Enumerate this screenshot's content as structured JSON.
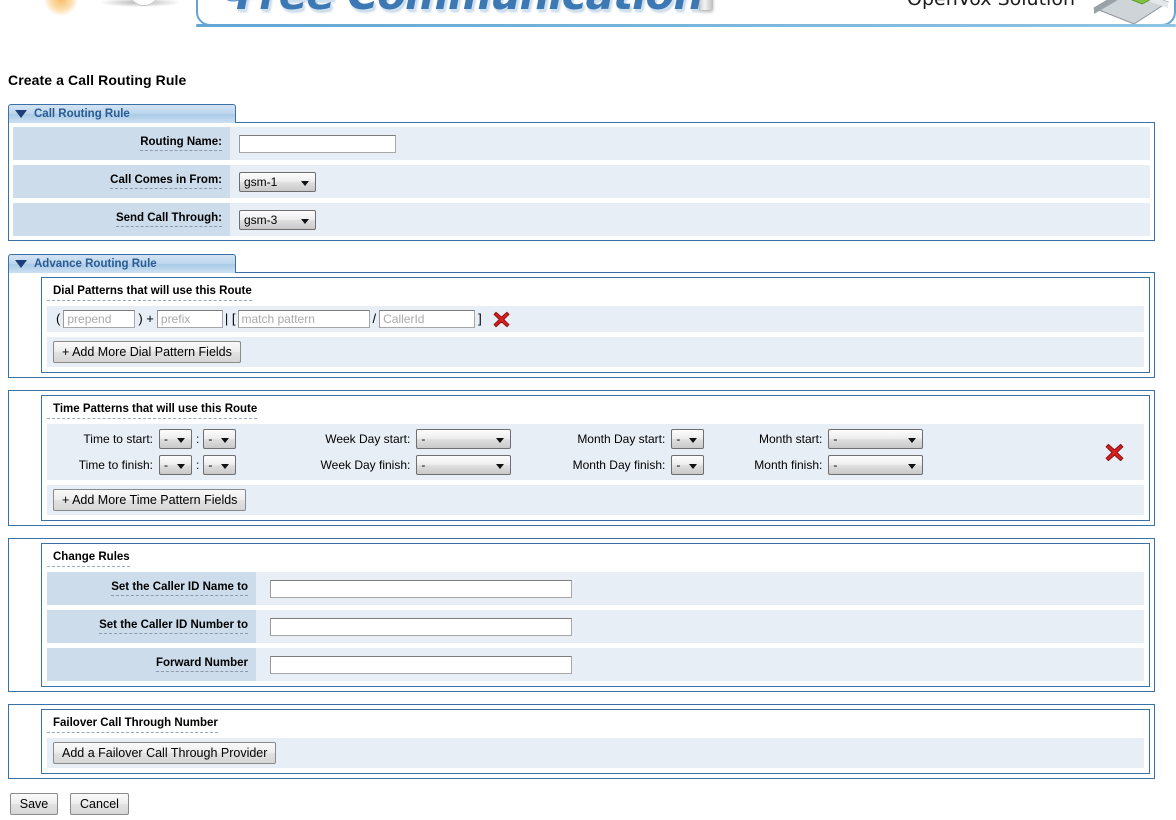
{
  "banner": {
    "title": "Free Communication",
    "subtitle": "OpenVox Solution"
  },
  "page": {
    "title": "Create a Call Routing Rule"
  },
  "call_routing_rule_panel": {
    "header_label": "Call Routing Rule",
    "rows": [
      {
        "label": "Routing Name:",
        "type": "text",
        "value": "",
        "placeholder": ""
      },
      {
        "label": "Call Comes in From:",
        "type": "select",
        "value": "gsm-1"
      },
      {
        "label": "Send Call Through:",
        "type": "select",
        "value": "gsm-3"
      }
    ]
  },
  "advance_routing_rule_panel": {
    "header_label": "Advance Routing Rule",
    "dial_patterns": {
      "title": "Dial Patterns that will use this Route",
      "open_paren": "(",
      "close_paren": ") +",
      "pipe_bracket": "| [",
      "slash": "/",
      "close_bracket": "]",
      "prepend_placeholder": "prepend",
      "prefix_placeholder": "prefix",
      "match_placeholder": "match pattern",
      "callerid_placeholder": "CallerId",
      "prepend_value": "",
      "prefix_value": "",
      "match_value": "",
      "callerid_value": "",
      "delete_icon": "red-x-icon",
      "add_button": "+ Add More Dial Pattern Fields"
    },
    "time_patterns": {
      "title": "Time Patterns that will use this Route",
      "labels": {
        "time_start": "Time to start:",
        "time_finish": "Time to finish:",
        "week_start": "Week Day start:",
        "week_finish": "Week Day finish:",
        "month_day_start": "Month Day start:",
        "month_day_finish": "Month Day finish:",
        "month_start": "Month start:",
        "month_finish": "Month finish:"
      },
      "colon": ":",
      "values": {
        "time_start_hour": "-",
        "time_start_min": "-",
        "time_finish_hour": "-",
        "time_finish_min": "-",
        "week_start": "-",
        "week_finish": "-",
        "month_day_start": "-",
        "month_day_finish": "-",
        "month_start": "-",
        "month_finish": "-"
      },
      "delete_icon": "red-x-icon",
      "add_button": "+ Add More Time Pattern Fields"
    },
    "change_rules": {
      "title": "Change Rules",
      "rows": [
        {
          "label": "Set the Caller ID Name to",
          "value": ""
        },
        {
          "label": "Set the Caller ID Number to",
          "value": ""
        },
        {
          "label": "Forward Number",
          "value": ""
        }
      ]
    },
    "failover": {
      "title": "Failover Call Through Number",
      "add_button": "Add a Failover Call Through Provider"
    }
  },
  "footer": {
    "save_label": "Save",
    "cancel_label": "Cancel"
  },
  "colors": {
    "panel_border": "#3a72a8",
    "panel_header_text": "#2a5b91",
    "label_cell_bg": "#ccdcea",
    "row_bg": "#e8eef6",
    "banner_blue": "#3c78b4",
    "delete_red": "#cc1f1f"
  }
}
